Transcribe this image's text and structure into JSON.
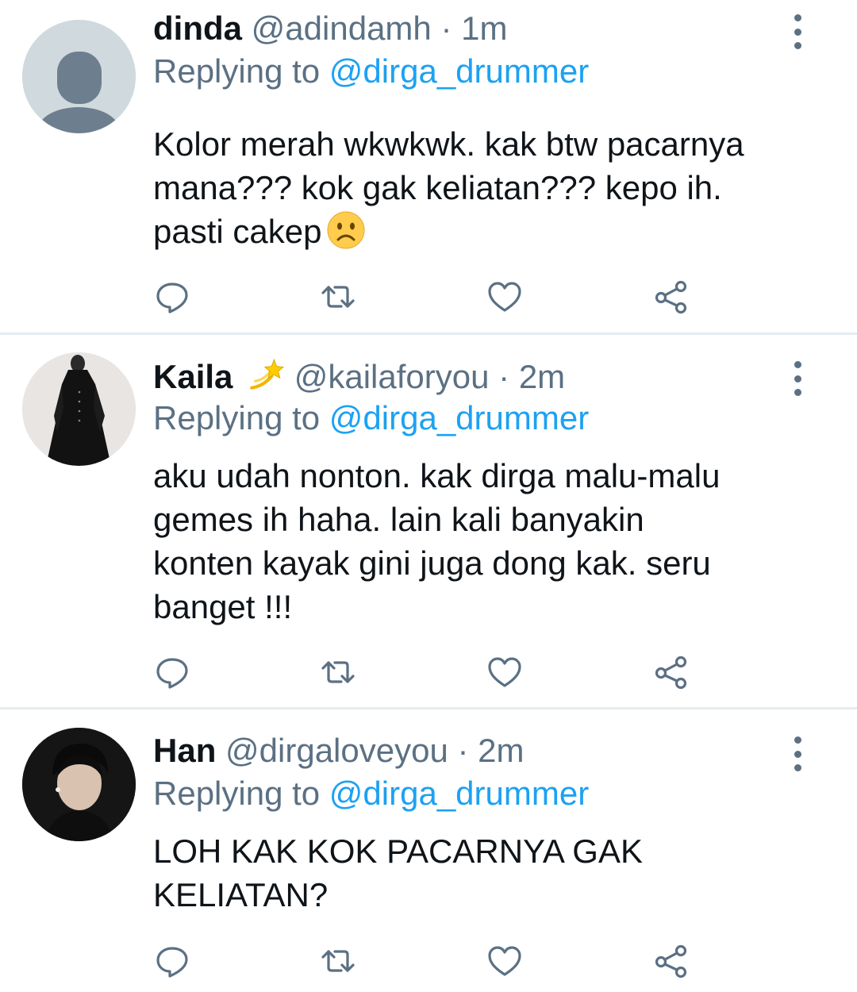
{
  "colors": {
    "name": "#0f1419",
    "muted": "#5b7083",
    "accent": "#1da1f2",
    "divider": "#e6ecf0"
  },
  "tweets": [
    {
      "name": "dinda",
      "handle": "@adindamh",
      "sep": "·",
      "time": "1m",
      "replying_prefix": "Replying to ",
      "replying_to": "@dirga_drummer",
      "lines": [
        "Kolor merah wkwkwk. kak btw pacarnya",
        "mana??? kok gak keliatan??? kepo ih.",
        "pasti cakep"
      ],
      "emoji": "frowning-face-emoji",
      "avatar": "default-avatar"
    },
    {
      "name": "Kaila",
      "name_emoji": "dizzy-emoji",
      "handle": "@kailaforyou",
      "sep": "·",
      "time": "2m",
      "replying_prefix": "Replying to ",
      "replying_to": "@dirga_drummer",
      "lines": [
        "aku udah nonton. kak dirga malu-malu",
        "gemes ih haha. lain kali banyakin",
        "konten kayak gini juga dong kak. seru",
        "banget !!!"
      ],
      "avatar": "photo-avatar-woman-black-dress"
    },
    {
      "name": "Han",
      "handle": "@dirgaloveyou",
      "sep": "·",
      "time": "2m",
      "replying_prefix": "Replying to ",
      "replying_to": "@dirga_drummer",
      "lines": [
        "LOH KAK KOK PACARNYA GAK",
        "KELIATAN?"
      ],
      "avatar": "photo-avatar-man"
    }
  ],
  "action_icons": [
    "reply-icon",
    "retweet-icon",
    "like-icon",
    "share-icon"
  ]
}
